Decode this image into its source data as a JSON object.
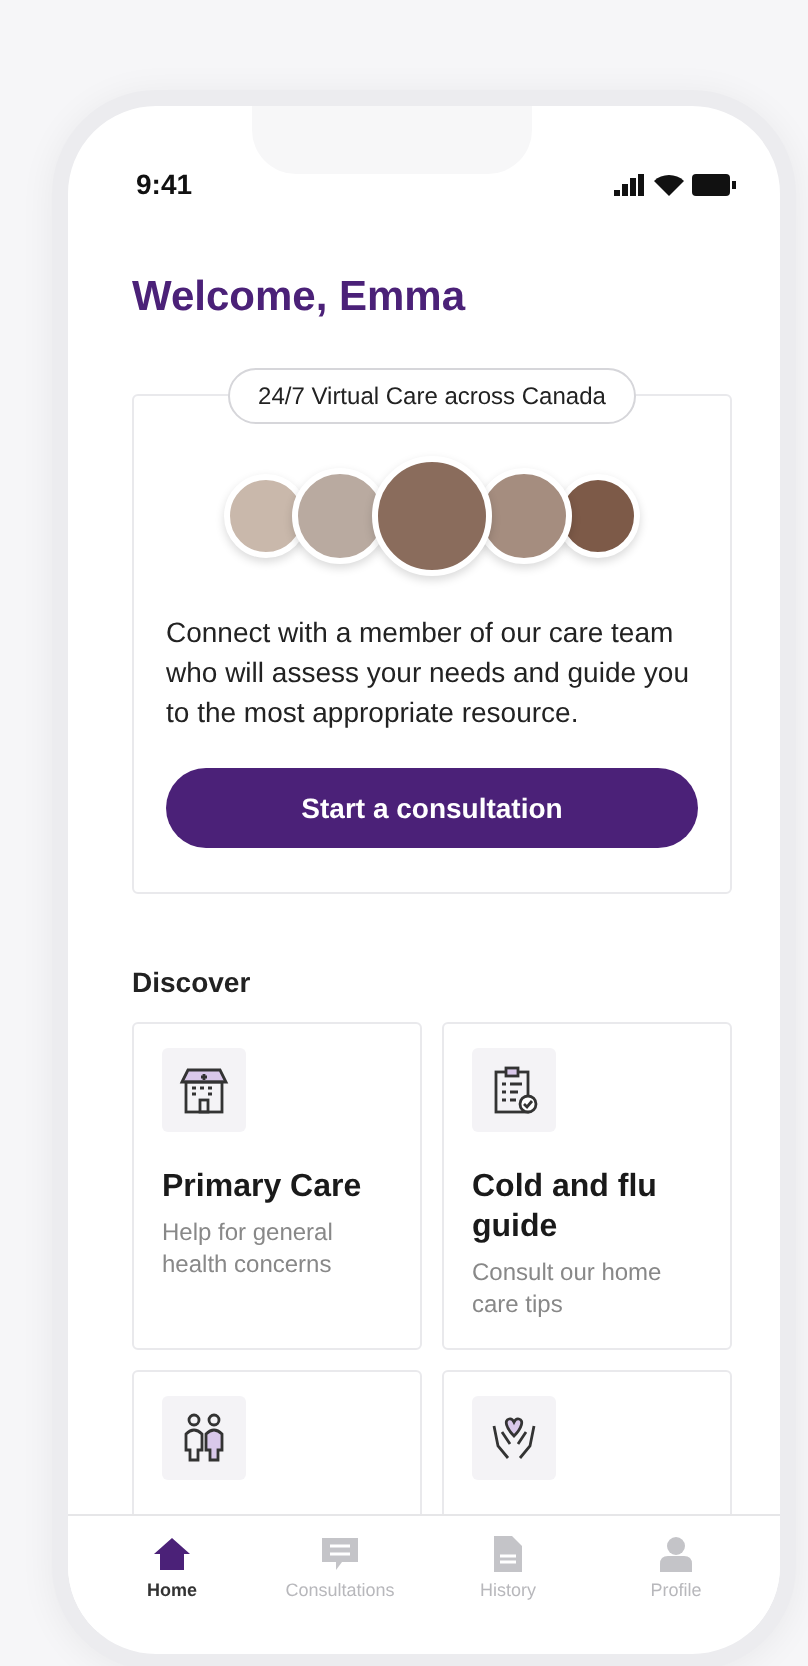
{
  "status_bar": {
    "time": "9:41"
  },
  "greeting": "Welcome, Emma",
  "care_card": {
    "badge": "24/7 Virtual Care across Canada",
    "description": "Connect with a member of our care team who will assess your needs and guide you to the most appropriate resource.",
    "button": "Start a consultation"
  },
  "discover": {
    "title": "Discover",
    "cards": [
      {
        "kind": "full",
        "title": "Primary Care",
        "subtitle": "Help for general health concerns"
      },
      {
        "kind": "full",
        "title": "Cold and flu guide",
        "subtitle": "Consult our home care tips"
      },
      {
        "kind": "cut"
      },
      {
        "kind": "cut"
      }
    ]
  },
  "tab_bar": [
    {
      "label": "Home",
      "selected": true
    },
    {
      "label": "Consultations",
      "selected": false
    },
    {
      "label": "History",
      "selected": false
    },
    {
      "label": "Profile",
      "selected": false
    }
  ]
}
